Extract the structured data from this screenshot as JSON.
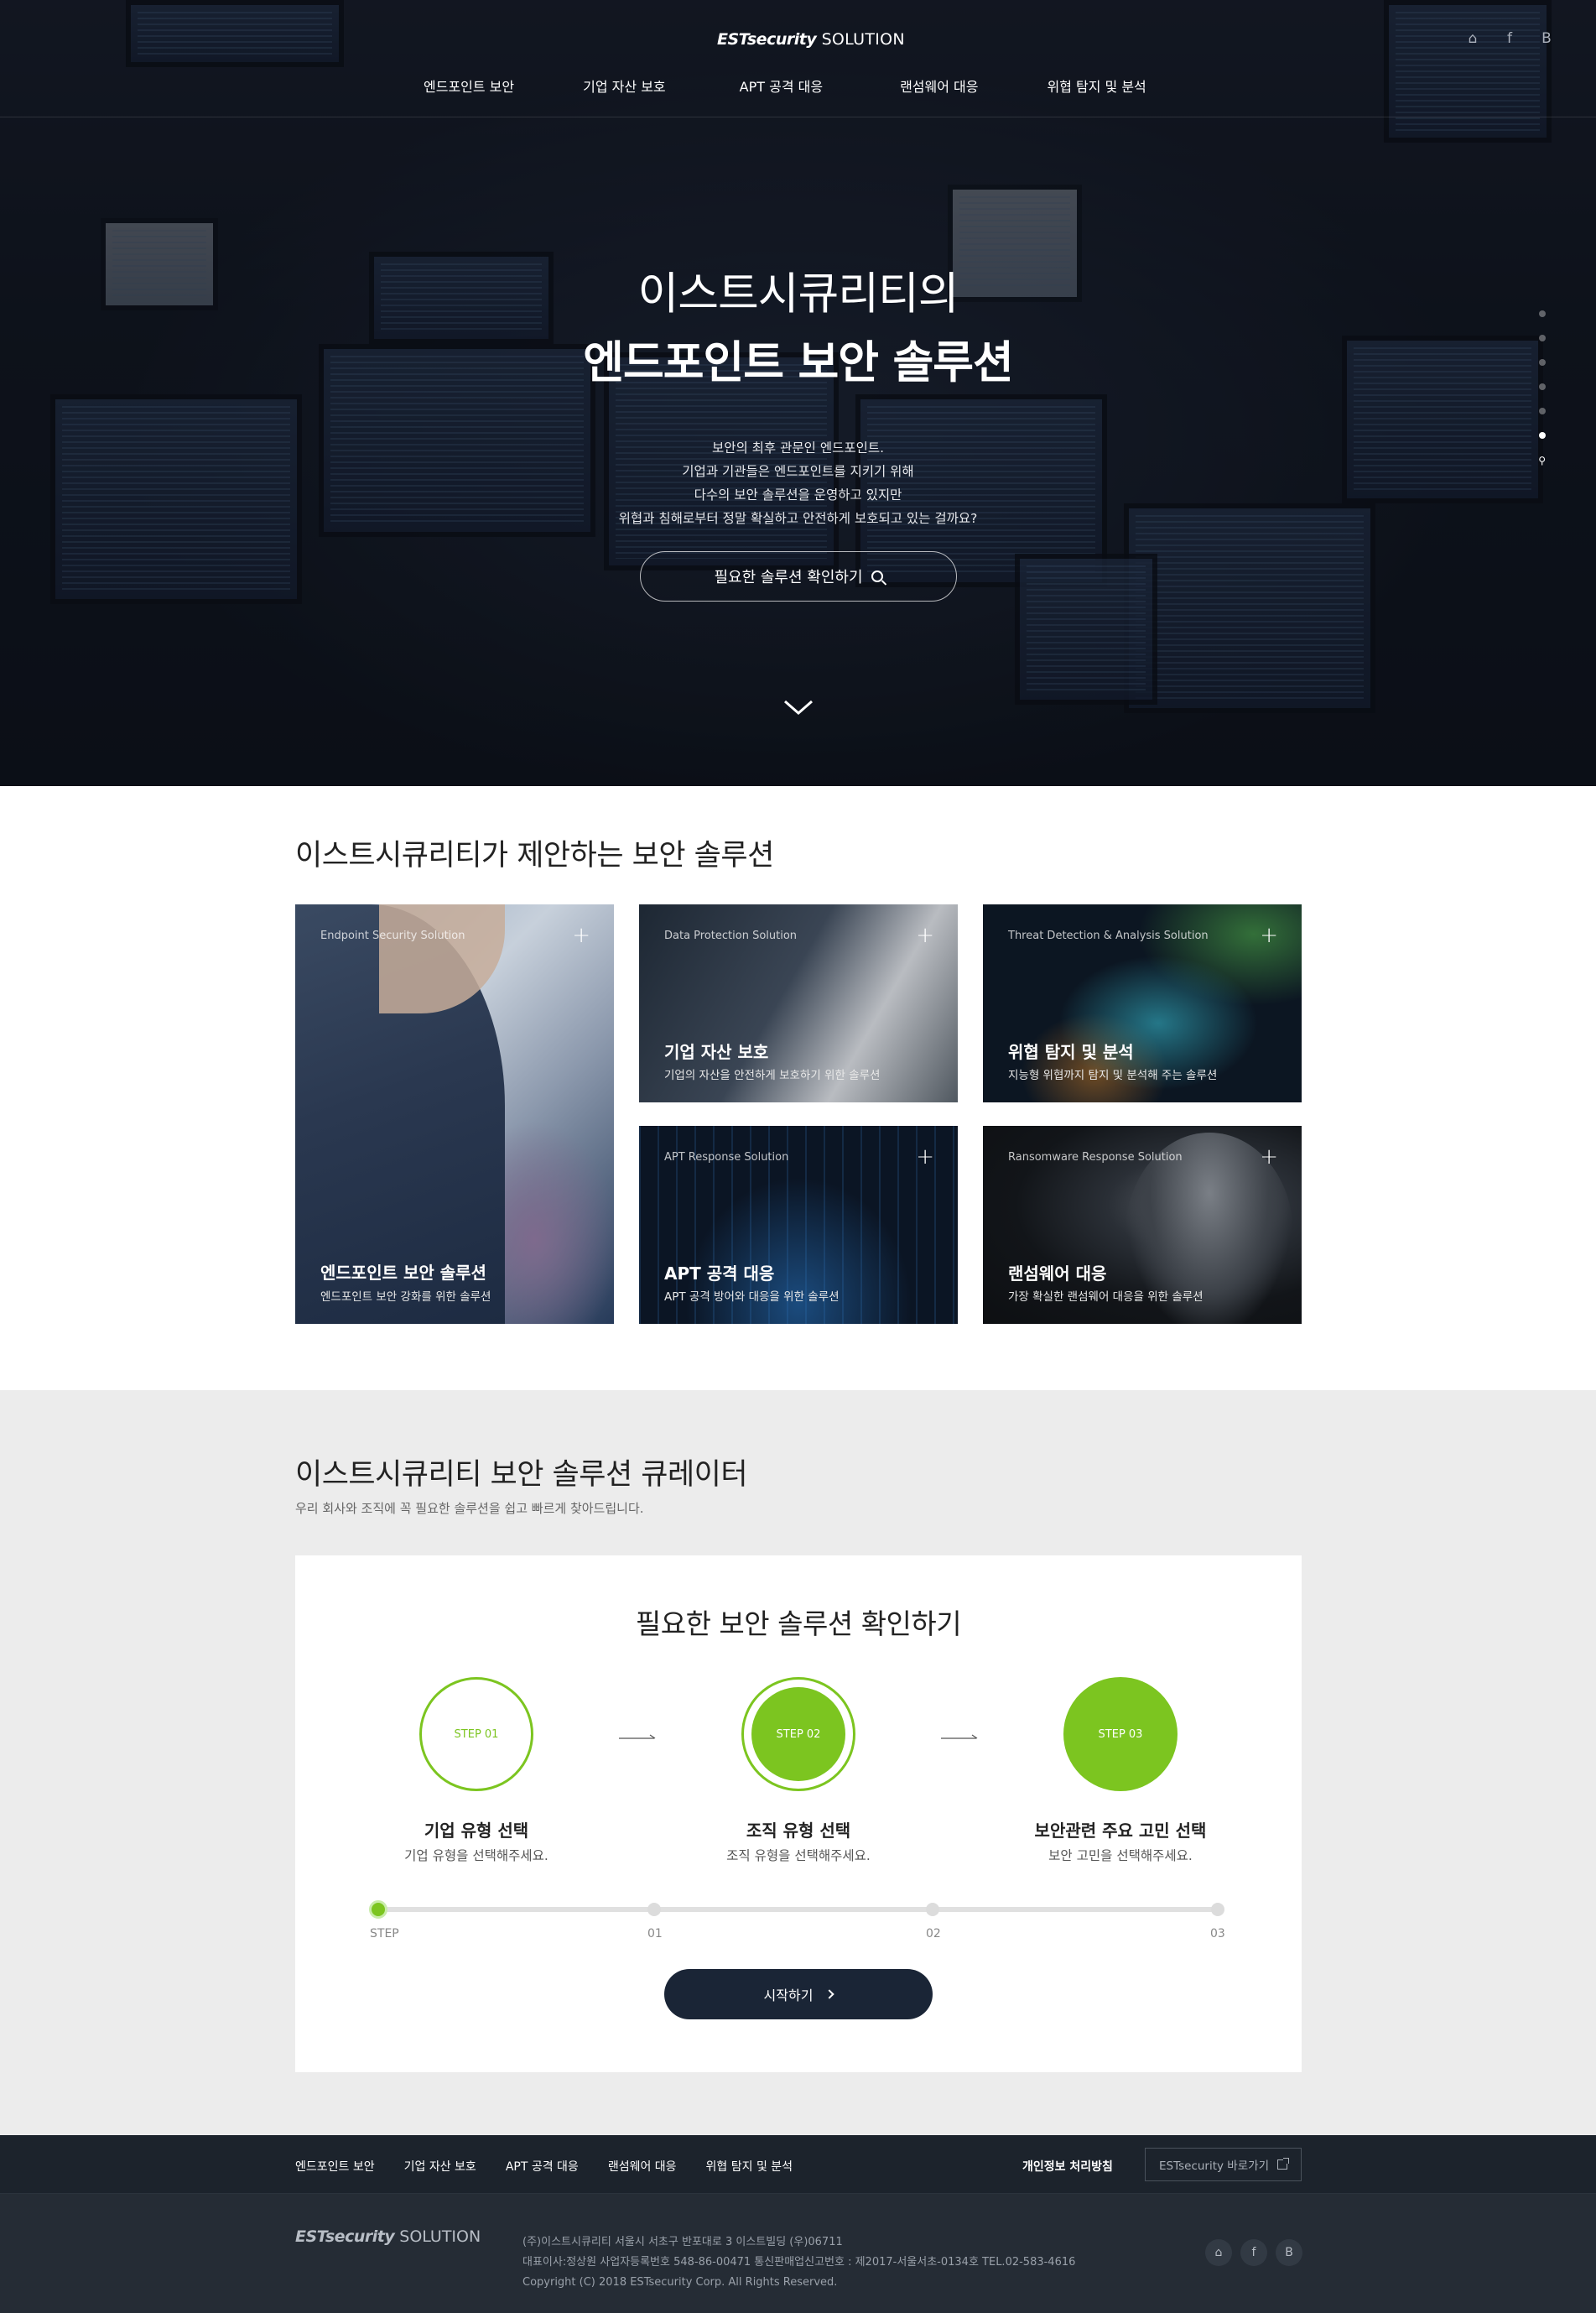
{
  "header": {
    "logo_brand": "ESTsecurity",
    "logo_suffix": "SOLUTION",
    "util": {
      "home_icon": "⌂",
      "facebook": "f",
      "blog": "B"
    },
    "nav": [
      "엔드포인트 보안",
      "기업 자산 보호",
      "APT 공격 대응",
      "랜섬웨어 대응",
      "위협 탐지 및 분석"
    ]
  },
  "hero": {
    "line1": "이스트시큐리티의",
    "line2": "엔드포인트 보안 솔루션",
    "desc": [
      "보안의 최후 관문인 엔드포인트.",
      "기업과 기관들은 엔드포인트를 지키기 위해",
      "다수의 보안 솔루션을 운영하고 있지만",
      "위협과 침해로부터 정말 확실하고 안전하게 보호되고 있는 걸까요?"
    ],
    "cta": "필요한 솔루션 확인하기",
    "search_glyph": "⚲"
  },
  "solutions": {
    "title": "이스트시큐리티가 제안하는 보안 솔루션",
    "plus": "+",
    "cards": [
      {
        "category": "Endpoint Security Solution",
        "title": "엔드포인트 보안 솔루션",
        "desc": "엔드포인트 보안 강화를 위한 솔루션"
      },
      {
        "category": "Data Protection Solution",
        "title": "기업 자산 보호",
        "desc": "기업의 자산을 안전하게 보호하기 위한 솔루션"
      },
      {
        "category": "Threat Detection & Analysis Solution",
        "title": "위협 탐지 및 분석",
        "desc": "지능형 위협까지 탐지 및 분석해 주는 솔루션"
      },
      {
        "category": "APT Response Solution",
        "title": "APT 공격 대응",
        "desc": "APT 공격 방어와 대응을 위한 솔루션"
      },
      {
        "category": "Ransomware Response Solution",
        "title": "랜섬웨어 대응",
        "desc": "가장 확실한 랜섬웨어 대응을 위한 솔루션"
      }
    ]
  },
  "curator": {
    "title": "이스트시큐리티 보안 솔루션 큐레이터",
    "subtitle": "우리 회사와 조직에 꼭 필요한 솔루션을 쉽고 빠르게 찾아드립니다.",
    "panel_title": "필요한 보안 솔루션 확인하기",
    "steps": [
      {
        "label": "STEP 01",
        "title": "기업 유형 선택",
        "desc": "기업 유형을 선택해주세요."
      },
      {
        "label": "STEP 02",
        "title": "조직 유형 선택",
        "desc": "조직 유형을 선택해주세요."
      },
      {
        "label": "STEP 03",
        "title": "보안관련 주요 고민 선택",
        "desc": "보안 고민을 선택해주세요."
      }
    ],
    "track_labels": [
      "STEP",
      "01",
      "02",
      "03"
    ],
    "track_progress": 0,
    "start": "시작하기"
  },
  "footer": {
    "links": [
      "엔드포인트 보안",
      "기업 자산 보호",
      "APT 공격 대응",
      "랜섬웨어 대응",
      "위협 탐지 및 분석"
    ],
    "privacy": "개인정보 처리방침",
    "goto": "ESTsecurity 바로가기",
    "logo_brand": "ESTsecurity",
    "logo_suffix": "SOLUTION",
    "info": [
      "(주)이스트시큐리티 서울시 서초구 반포대로 3 이스트빌딩 (우)06711",
      "대표이사:정상원 사업자등록번호 548-86-00471 통신판매업신고번호 : 제2017-서울서초-0134호 TEL.02-583-4616",
      "Copyright (C) 2018 ESTsecurity Corp. All Rights Reserved."
    ],
    "social": {
      "home": "⌂",
      "facebook": "f",
      "blog": "B"
    }
  },
  "colors": {
    "accent": "#7cc520",
    "dark_button": "#1a2536",
    "footer_top": "#1c232c",
    "footer_bottom": "#252c35",
    "curator_bg": "#ececec"
  }
}
